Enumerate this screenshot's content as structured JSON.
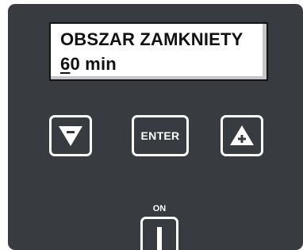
{
  "display": {
    "line1": "OBSZAR ZAMKNIETY",
    "line2_cursor": "6",
    "line2_rest": "0 min"
  },
  "buttons": {
    "down": {
      "icon": "triangle-down-minus-icon",
      "glyph": "−"
    },
    "enter": {
      "label": "ENTER"
    },
    "up": {
      "icon": "triangle-up-plus-icon",
      "glyph": "+"
    }
  },
  "power": {
    "label": "ON",
    "icon": "power-bar-icon"
  },
  "colors": {
    "panel": "#383b40",
    "display_bg": "#ffffff",
    "text": "#111111",
    "key_border": "#ffffff"
  }
}
